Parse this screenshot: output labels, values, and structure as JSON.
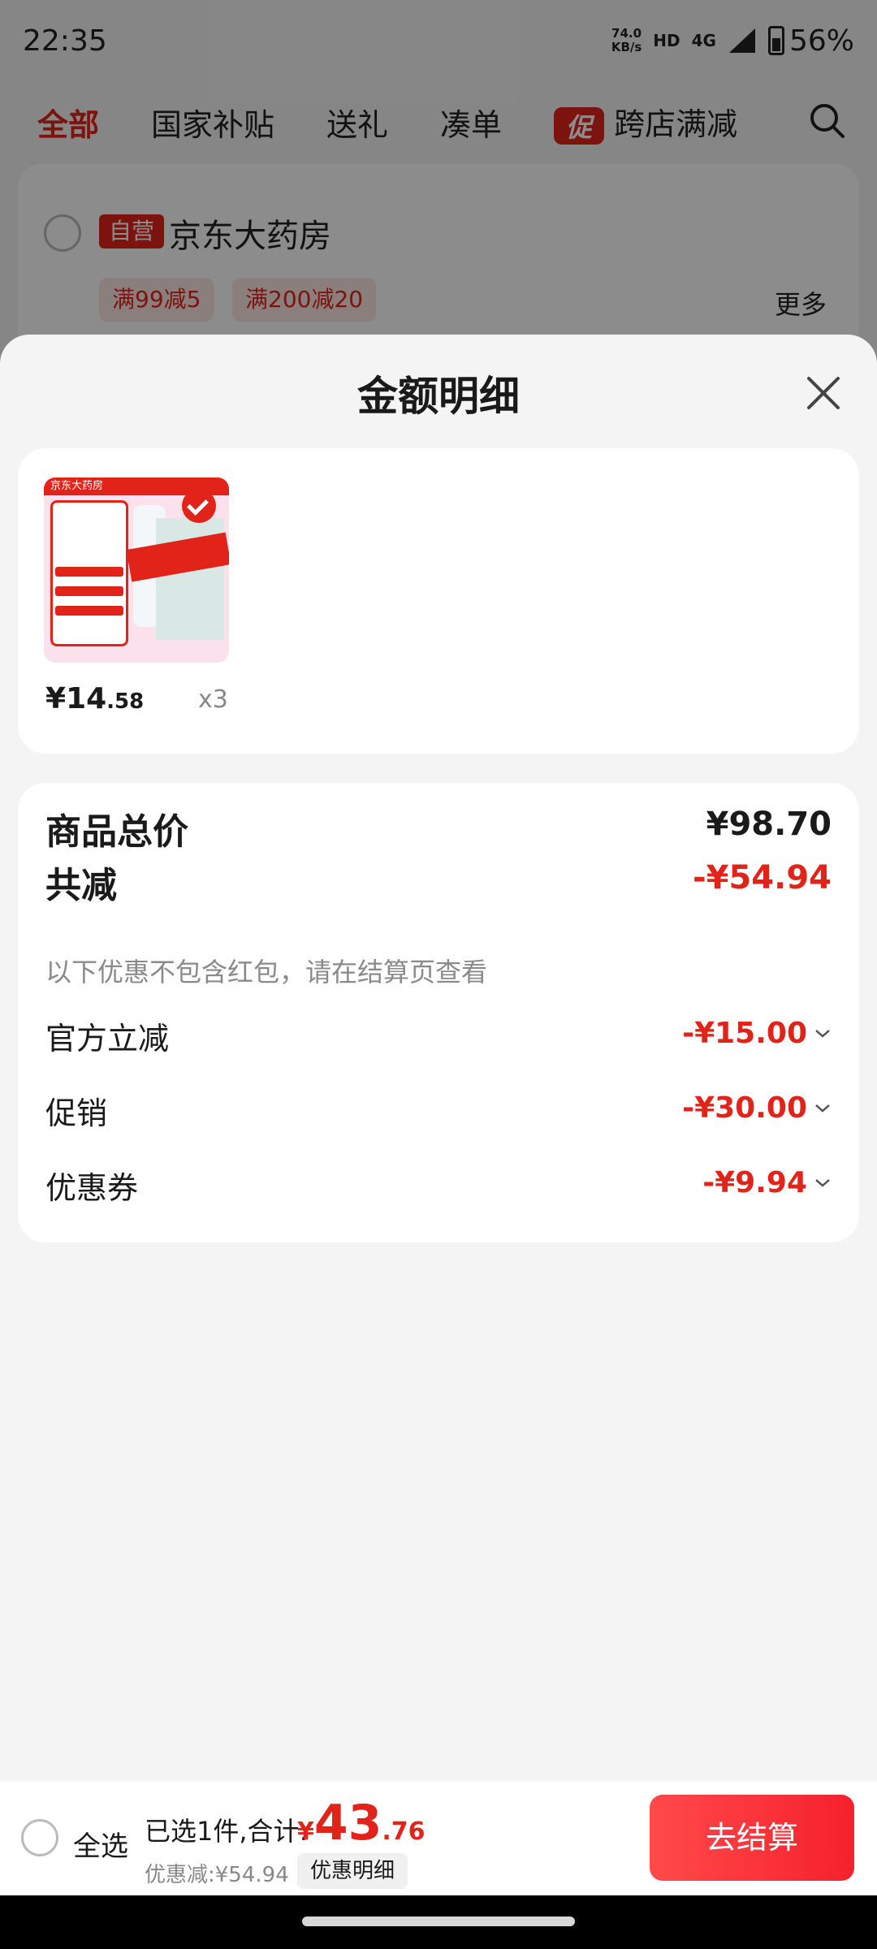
{
  "status_bar": {
    "time": "22:35",
    "net_speed_value": "74.0",
    "net_speed_unit": "KB/s",
    "sim1": "HD",
    "network": "4G",
    "battery": "56%"
  },
  "tabs": [
    {
      "label": "全部",
      "active": true
    },
    {
      "label": "国家补贴",
      "active": false
    },
    {
      "label": "送礼",
      "active": false
    },
    {
      "label": "凑单",
      "active": false
    }
  ],
  "promo_tab": {
    "tag": "促",
    "label": "跨店满减"
  },
  "store": {
    "tag": "自营",
    "name": "京东大药房",
    "coupons": [
      "满99减5",
      "满200减20"
    ],
    "more": "更多"
  },
  "sheet": {
    "title": "金额明细",
    "product": {
      "price_symbol": "¥",
      "price_int": "14",
      "price_dec": ".58",
      "quantity": "x3",
      "thumb_header": "京东大药房"
    },
    "summary": {
      "total_label": "商品总价",
      "total_value": "¥98.70",
      "reduce_label": "共减",
      "reduce_value": "-¥54.94",
      "note": "以下优惠不包含红包，请在结算页查看",
      "items": [
        {
          "label": "官方立减",
          "value": "-¥15.00"
        },
        {
          "label": "促销",
          "value": "-¥30.00"
        },
        {
          "label": "优惠券",
          "value": "-¥9.94"
        }
      ]
    }
  },
  "bottom_bar": {
    "select_all": "全选",
    "selected_text": "已选1件,合计:",
    "total_symbol": "¥",
    "total_int": "43",
    "total_dec": ".76",
    "saved_text": "优惠减:¥54.94",
    "detail_chip": "优惠明细",
    "checkout": "去结算"
  },
  "colors": {
    "accent": "#e2231a",
    "background": "#f4f4f4"
  }
}
